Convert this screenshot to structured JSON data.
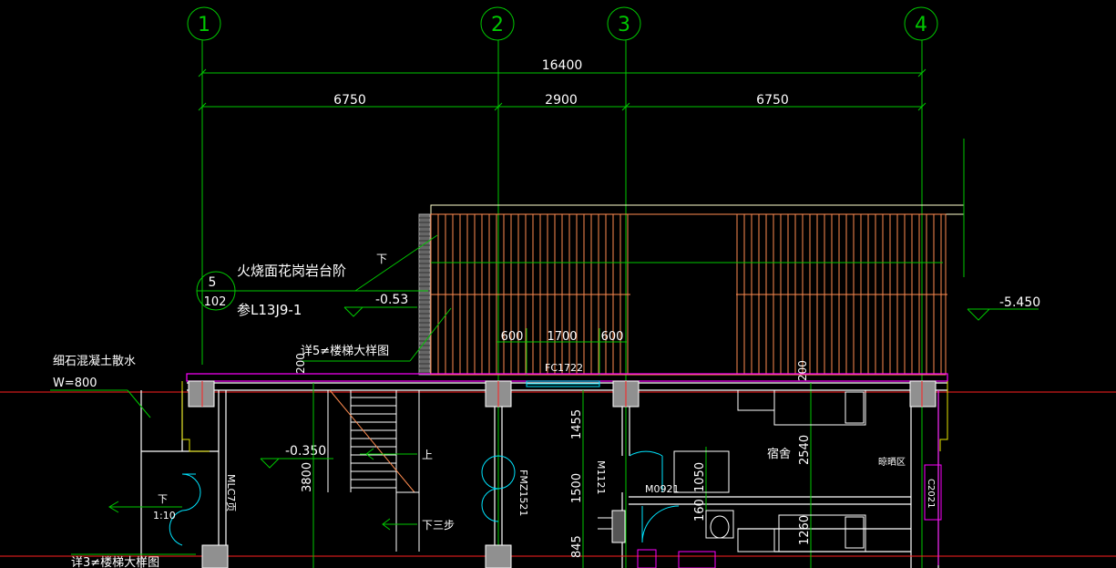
{
  "colors": {
    "background": "#000000",
    "axis_green": "#00c800",
    "wall_white": "#ffffff",
    "stair_orange": "#ff8c50",
    "grey_column": "#909090",
    "red_axis": "#ff2020",
    "magenta": "#ff00ff",
    "cyan": "#00e5ff",
    "yellow": "#e6e600"
  },
  "grid": {
    "axis_1": "1",
    "axis_2": "2",
    "axis_3": "3",
    "axis_4": "4"
  },
  "dimensions": {
    "overall": "16400",
    "bay_1_2": "6750",
    "bay_2_3": "2900",
    "bay_3_4": "6750",
    "opening_left": "600",
    "opening_mid": "1700",
    "opening_right": "600",
    "slab_left": "200",
    "slab_right": "200",
    "v_1455": "1455",
    "v_1500": "1500",
    "v_845": "845",
    "v_3800": "3800",
    "v_1050": "1050",
    "v_160": "160",
    "v_2540": "2540",
    "v_1260": "1260"
  },
  "annotations": {
    "detail_num": "5",
    "detail_sheet": "102",
    "steps_title": "火烧面花岗岩台阶",
    "steps_ref": "参L13J9-1",
    "elev_053": "-0.53",
    "elev_5450": "-5.450",
    "elev_0350": "-0.350",
    "stair_detail_5": "详5≠楼梯大样图",
    "stair_detail_3": "详3≠楼梯大样图",
    "apron_title": "细石混凝土散水",
    "apron_width": "W=800",
    "down_label": "下",
    "up_label": "上",
    "down_steps": "下三步",
    "slope_down": "下",
    "slope_ratio": "1:10",
    "window_fc": "FC1722",
    "door_mlc": "MLC7页",
    "door_fm": "FMZ1521",
    "door_m1121": "M1121",
    "door_m0921": "M0921",
    "room_dorm": "宿舍",
    "room_drying": "晾晒区",
    "window_c": "C2021"
  }
}
